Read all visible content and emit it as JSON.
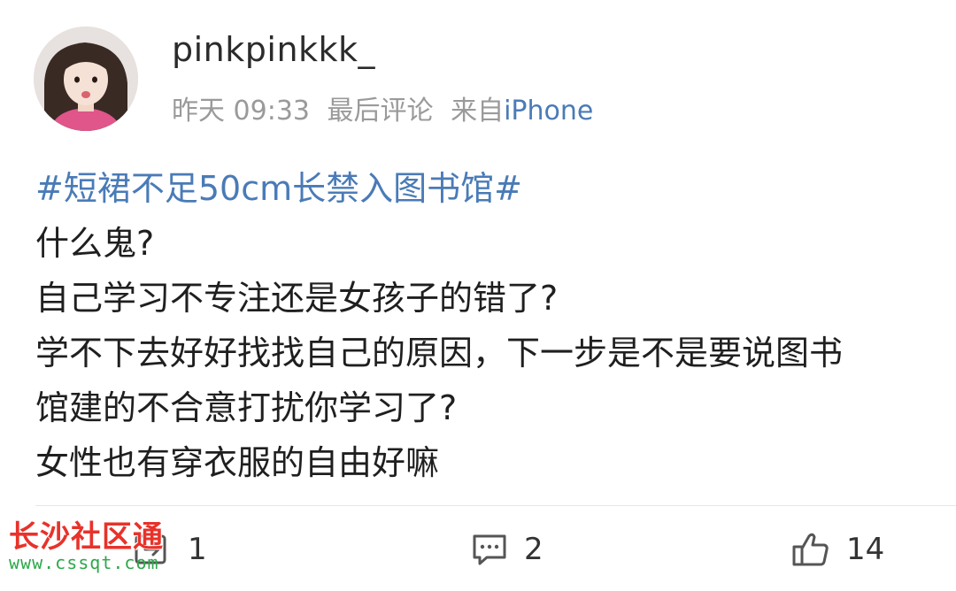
{
  "post": {
    "username": "pinkpinkkk_",
    "meta": {
      "date": "昨天 09:33",
      "comment_label": "最后评论",
      "source_prefix": "来自",
      "source_device": "iPhone"
    },
    "hashtag": "#短裙不足50cm长禁入图书馆#",
    "lines": [
      "什么鬼?",
      "自己学习不专注还是女孩子的错了?",
      "学不下去好好找找自己的原因，下一步是不是要说图书",
      "馆建的不合意打扰你学习了?",
      "女性也有穿衣服的自由好嘛"
    ]
  },
  "actions": {
    "repost": {
      "icon": "repost-icon",
      "count": "1"
    },
    "comment": {
      "icon": "comment-icon",
      "count": "2"
    },
    "like": {
      "icon": "thumbs-up-icon",
      "count": "14"
    }
  },
  "watermark": {
    "title": "长沙社区通",
    "url": "www.cssqt.com"
  },
  "colors": {
    "link": "#4a7bb7",
    "meta_text": "#9a9a9a",
    "watermark_red": "#e8322a",
    "watermark_green": "#2ea84c"
  }
}
